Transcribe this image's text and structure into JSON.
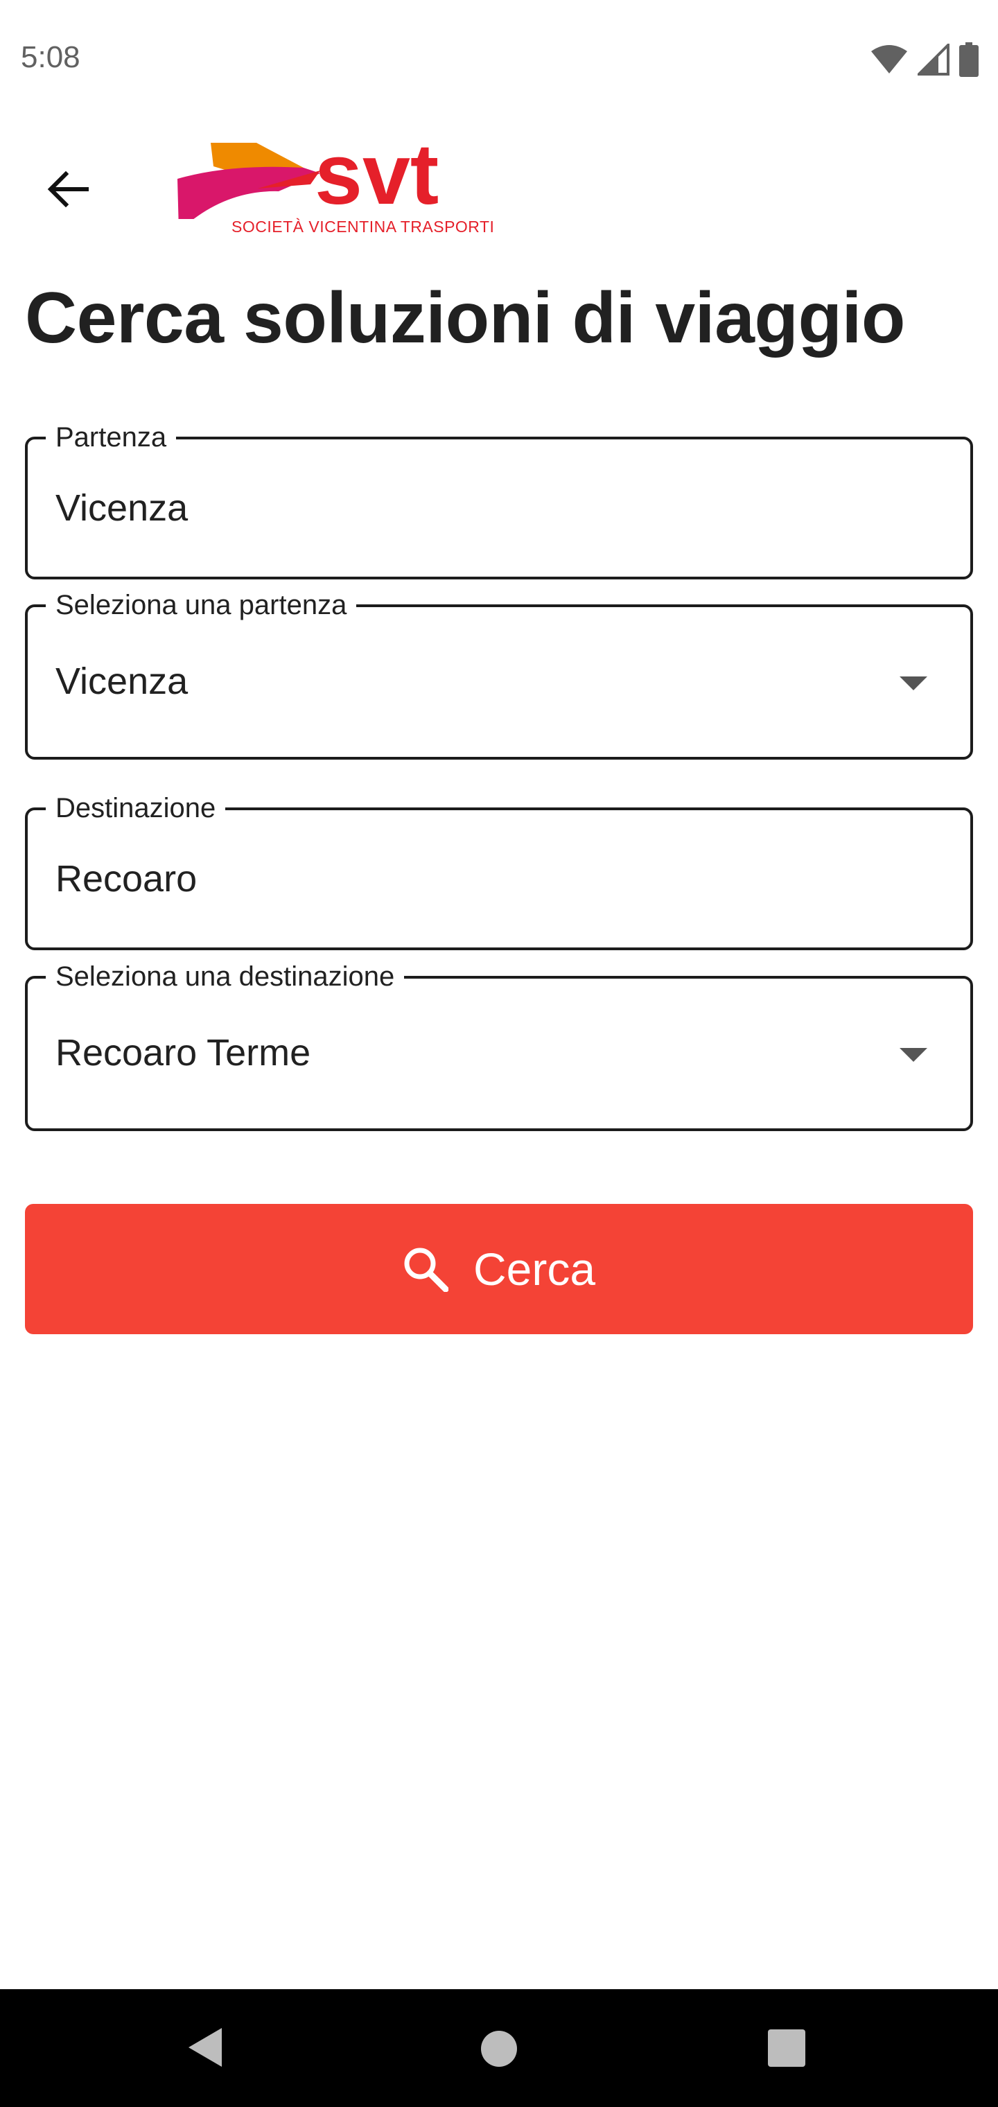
{
  "status_bar": {
    "time": "5:08",
    "icons": [
      "wifi-icon",
      "signal-icon",
      "battery-icon"
    ]
  },
  "app_bar": {
    "back_icon": "arrow-back-icon",
    "logo": {
      "wordmark": "svt",
      "caption": "SOCIETÀ VICENTINA TRASPORTI"
    }
  },
  "page": {
    "title": "Cerca soluzioni di viaggio"
  },
  "form": {
    "departure": {
      "label": "Partenza",
      "value": "Vicenza"
    },
    "departure_select": {
      "label": "Seleziona una partenza",
      "value": "Vicenza"
    },
    "destination": {
      "label": "Destinazione",
      "value": "Recoaro"
    },
    "destination_select": {
      "label": "Seleziona una destinazione",
      "value": "Recoaro Terme"
    }
  },
  "search_button": {
    "label": "Cerca",
    "icon": "search-icon",
    "color": "#f44336"
  },
  "nav_bar": {
    "icons": [
      "nav-back-icon",
      "nav-home-icon",
      "nav-recents-icon"
    ]
  }
}
